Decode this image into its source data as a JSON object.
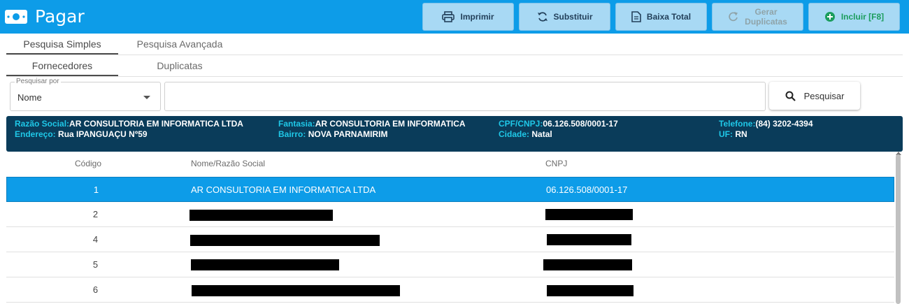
{
  "app": {
    "title": "Pagar"
  },
  "toolbar": {
    "print": "Imprimir",
    "replace": "Substituir",
    "total_write_off": "Baixa Total",
    "generate_line1": "Gerar",
    "generate_line2": "Duplicatas",
    "add": "Incluir [F8]"
  },
  "tabs": {
    "simple": "Pesquisa Simples",
    "advanced": "Pesquisa Avançada"
  },
  "subtabs": {
    "suppliers": "Fornecedores",
    "duplicates": "Duplicatas"
  },
  "search": {
    "legend": "Pesquisar por",
    "field": "Nome",
    "value": "",
    "button": "Pesquisar"
  },
  "info": {
    "razao_label": "Razão Social:",
    "razao": "AR CONSULTORIA EM INFORMATICA LTDA",
    "endereco_label": "Endereço:",
    "endereco": "Rua IPANGUAÇU Nº59",
    "fantasia_label": "Fantasia:",
    "fantasia": "AR CONSULTORIA EM INFORMATICA",
    "bairro_label": "Bairro:",
    "bairro": "NOVA PARNAMIRIM",
    "cnpj_label": "CPF/CNPJ:",
    "cnpj": "06.126.508/0001-17",
    "cidade_label": "Cidade:",
    "cidade": "Natal",
    "telefone_label": "Telefone:",
    "telefone": "(84) 3202-4394",
    "uf_label": "UF:",
    "uf": "RN"
  },
  "table": {
    "headers": {
      "code": "Código",
      "name": "Nome/Razão Social",
      "cnpj": "CNPJ"
    },
    "rows": [
      {
        "code": "1",
        "name": "AR CONSULTORIA EM INFORMATICA LTDA",
        "cnpj": "06.126.508/0001-17"
      },
      {
        "code": "2",
        "name": "",
        "cnpj": ""
      },
      {
        "code": "4",
        "name": "",
        "cnpj": ""
      },
      {
        "code": "5",
        "name": "",
        "cnpj": ""
      },
      {
        "code": "6",
        "name": "",
        "cnpj": ""
      }
    ]
  },
  "colors": {
    "primary": "#0d9ce8",
    "info_bg": "#0a3c5a",
    "info_key": "#1fc8e8",
    "add_green": "#1c9d5d"
  }
}
